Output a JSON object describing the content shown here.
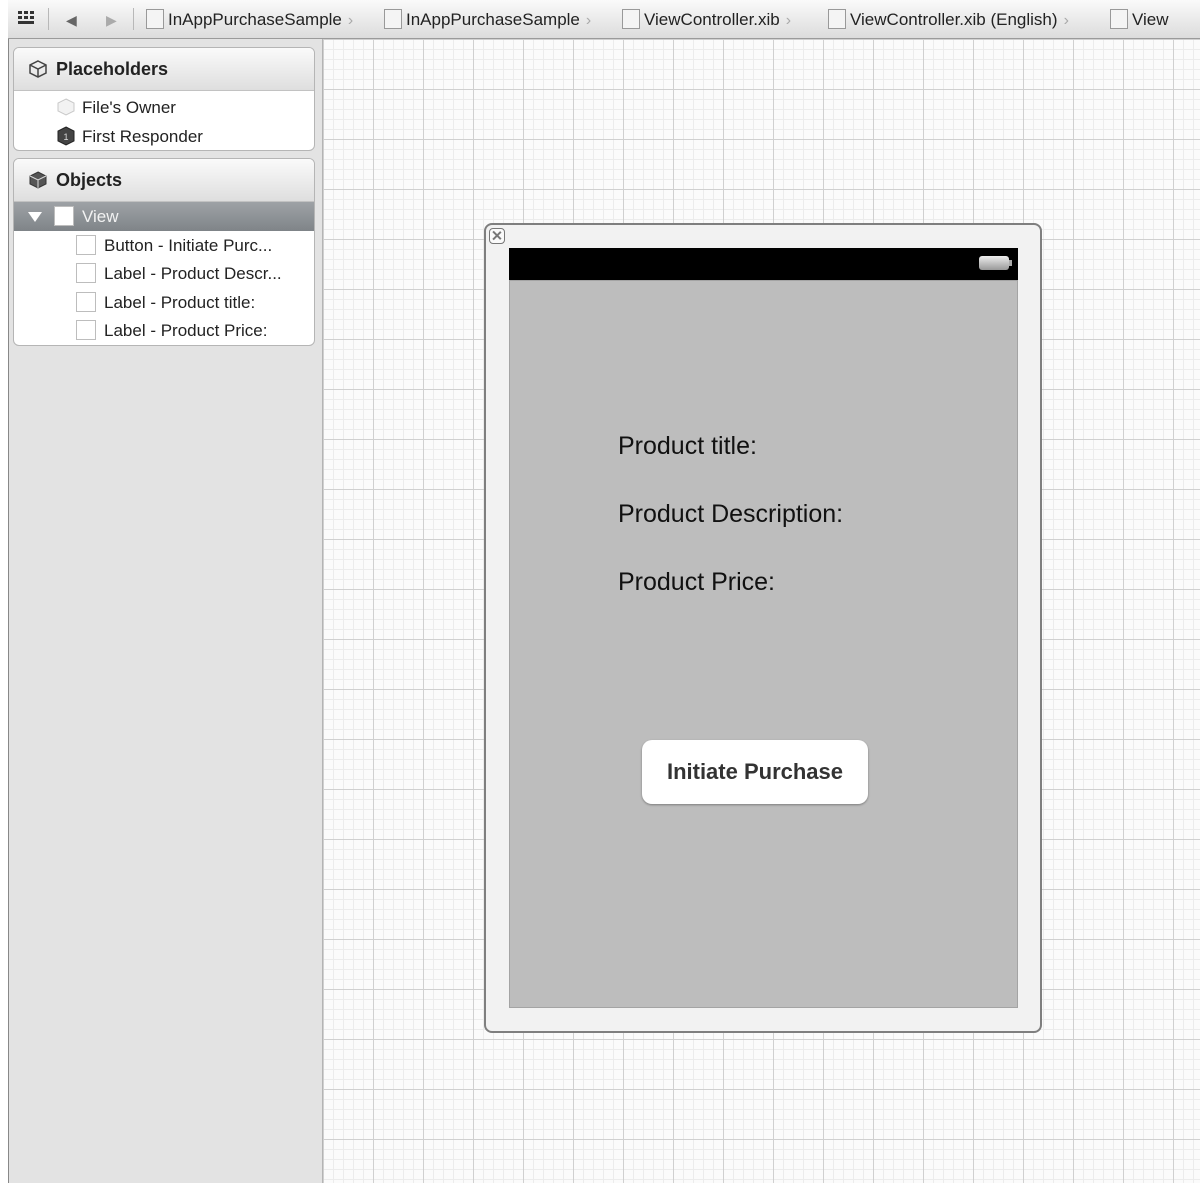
{
  "jumpbar": {
    "crumbs": [
      "InAppPurchaseSample",
      "InAppPurchaseSample",
      "ViewController.xib",
      "ViewController.xib (English)",
      "View"
    ]
  },
  "sidebar": {
    "placeholders": {
      "title": "Placeholders",
      "items": [
        {
          "label": "File's Owner",
          "icon": "files-owner-icon"
        },
        {
          "label": "First Responder",
          "icon": "first-responder-icon"
        }
      ]
    },
    "objects": {
      "title": "Objects",
      "view_label": "View",
      "items": [
        {
          "label": "Button - Initiate Purc..."
        },
        {
          "label": "Label - Product Descr..."
        },
        {
          "label": "Label - Product title:"
        },
        {
          "label": "Label - Product Price:"
        }
      ]
    }
  },
  "canvas": {
    "labels": {
      "title": "Product title:",
      "description": "Product Description:",
      "price": "Product Price:"
    },
    "button": "Initiate Purchase"
  },
  "colors": {
    "selection": "#8a8e92",
    "screen": "#bdbdbd",
    "statusbar": "#000000"
  }
}
